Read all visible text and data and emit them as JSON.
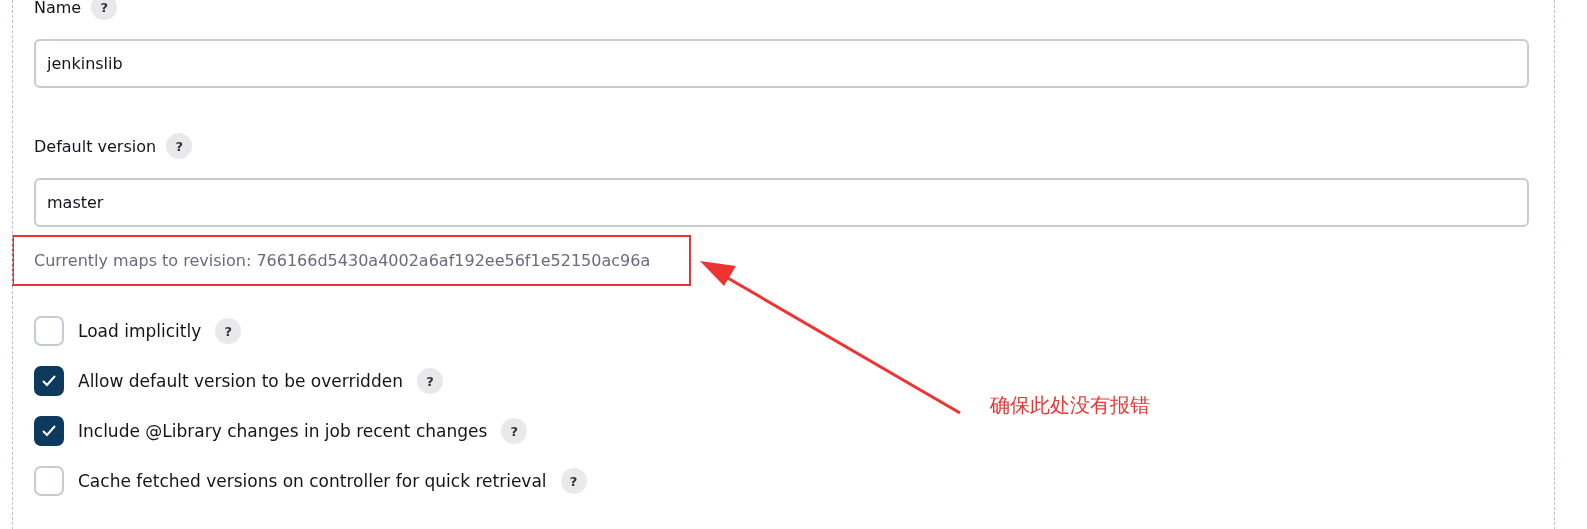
{
  "fields": [
    {
      "label": "Name",
      "help": "?",
      "value": "jenkinslib"
    },
    {
      "label": "Default version",
      "help": "?",
      "value": "master",
      "note": "Currently maps to revision: 766166d5430a4002a6af192ee56f1e52150ac96a"
    }
  ],
  "options": [
    {
      "label": "Load implicitly",
      "help": "?",
      "checked": false
    },
    {
      "label": "Allow default version to be overridden",
      "help": "?",
      "checked": true
    },
    {
      "label": "Include @Library changes in job recent changes",
      "help": "?",
      "checked": true
    },
    {
      "label": "Cache fetched versions on controller for quick retrieval",
      "help": "?",
      "checked": false
    }
  ],
  "annotation": {
    "text": "确保此处没有报错"
  }
}
